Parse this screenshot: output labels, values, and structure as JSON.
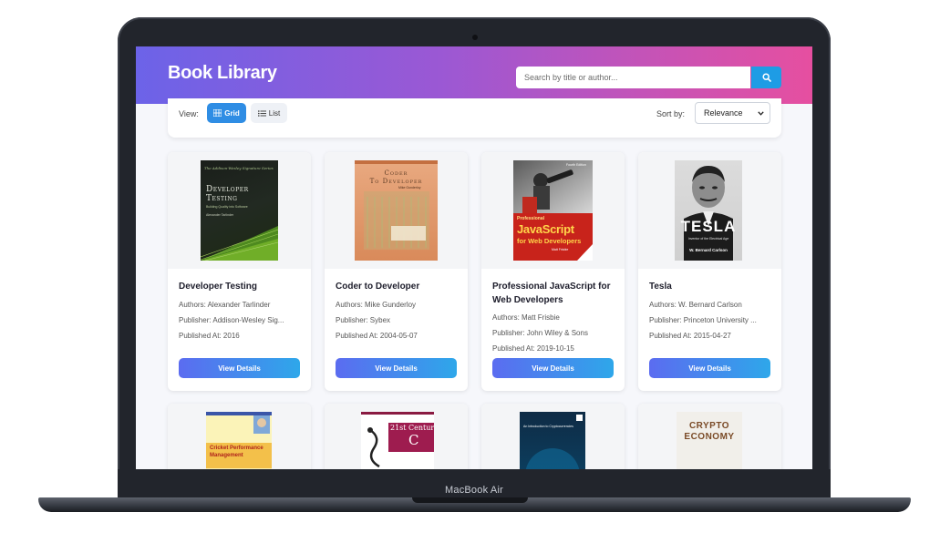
{
  "device": {
    "label": "MacBook Air"
  },
  "header": {
    "title": "Book Library",
    "search": {
      "placeholder": "Search by title or author...",
      "value": ""
    }
  },
  "toolbar": {
    "view_label": "View:",
    "grid_label": "Grid",
    "list_label": "List",
    "active_view": "Grid",
    "sort_label": "Sort by:",
    "sort_value": "Relevance"
  },
  "books": [
    {
      "title": "Developer Testing",
      "authors": "Authors: Alexander Tarlinder",
      "publisher": "Publisher: Addison-Wesley Sig...",
      "published": "Published At: 2016",
      "button": "View Details",
      "cover": {
        "top": "The Addison-Wesley Signature Series",
        "lines": [
          "Developer",
          "Testing"
        ],
        "sub": "Building Quality into Software",
        "author": "Alexander Tarlinder"
      }
    },
    {
      "title": "Coder to Developer",
      "authors": "Authors: Mike Gunderloy",
      "publisher": "Publisher: Sybex",
      "published": "Published At: 2004-05-07",
      "button": "View Details",
      "cover": {
        "lines": [
          "Coder",
          "To Developer"
        ],
        "author": "Mike Gunderloy"
      }
    },
    {
      "title": "Professional JavaScript for Web Developers",
      "authors": "Authors: Matt Frisbie",
      "publisher": "Publisher: John Wiley & Sons",
      "published": "Published At: 2019-10-15",
      "button": "View Details",
      "cover": {
        "edition": "Fourth Edition",
        "series": "Professional",
        "lines": [
          "JavaScript",
          "for Web Developers"
        ],
        "author": "Matt Frisbie"
      }
    },
    {
      "title": "Tesla",
      "authors": "Authors: W. Bernard Carlson",
      "publisher": "Publisher: Princeton University ...",
      "published": "Published At: 2015-04-27",
      "button": "View Details",
      "cover": {
        "lines": [
          "TESLA"
        ],
        "sub": "Inventor of the Electrical Age",
        "author": "W. Bernard Carlson"
      }
    }
  ],
  "books_row2": [
    {
      "cover": {
        "lines": [
          "Cricket Performance",
          "Management"
        ]
      }
    },
    {
      "cover": {
        "lines": [
          "21st Century",
          "C"
        ]
      }
    },
    {
      "cover": {
        "lines": [
          "An Introduction to Cryptocurrencies"
        ]
      }
    },
    {
      "cover": {
        "lines": [
          "Crypto",
          "Economy"
        ]
      }
    }
  ]
}
